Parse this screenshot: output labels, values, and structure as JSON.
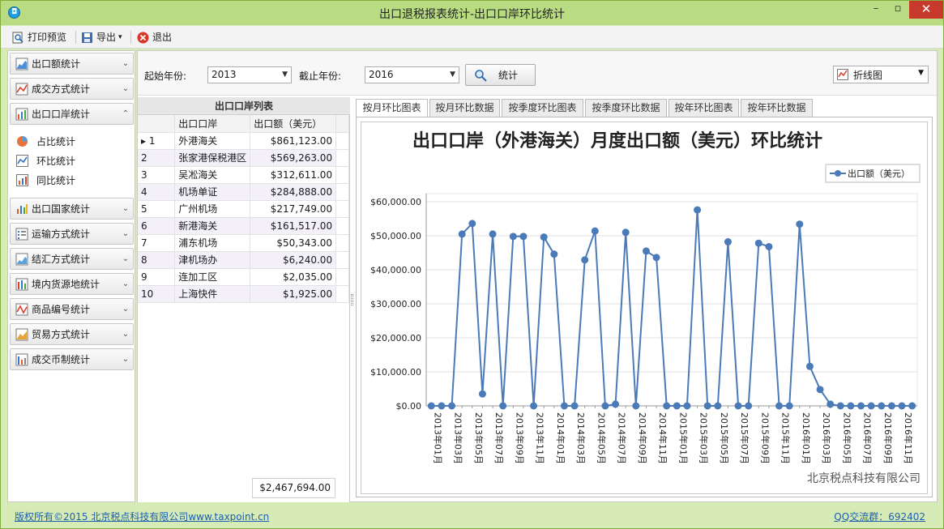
{
  "window": {
    "title": "出口退税报表统计-出口口岸环比统计"
  },
  "toolbar": {
    "print_preview": "打印预览",
    "export": "导出",
    "exit": "退出"
  },
  "sidebar": {
    "groups": [
      {
        "label": "出口额统计",
        "expanded": false
      },
      {
        "label": "成交方式统计",
        "expanded": false
      },
      {
        "label": "出口口岸统计",
        "expanded": true
      },
      {
        "label": "出口国家统计",
        "expanded": false
      },
      {
        "label": "运输方式统计",
        "expanded": false
      },
      {
        "label": "结汇方式统计",
        "expanded": false
      },
      {
        "label": "境内货源地统计",
        "expanded": false
      },
      {
        "label": "商品编号统计",
        "expanded": false
      },
      {
        "label": "贸易方式统计",
        "expanded": false
      },
      {
        "label": "成交币制统计",
        "expanded": false
      }
    ],
    "sub_items": [
      "占比统计",
      "环比统计",
      "同比统计"
    ]
  },
  "filters": {
    "start_label": "起始年份:",
    "start_value": "2013",
    "end_label": "截止年份:",
    "end_value": "2016",
    "stat_button": "统计",
    "chart_type": "折线图"
  },
  "grid": {
    "caption": "出口口岸列表",
    "columns": [
      "出口口岸",
      "出口额（美元）"
    ],
    "rows": [
      {
        "idx": "1",
        "port": "外港海关",
        "amount": "$861,123.00"
      },
      {
        "idx": "2",
        "port": "张家港保税港区",
        "amount": "$569,263.00"
      },
      {
        "idx": "3",
        "port": "吴凇海关",
        "amount": "$312,611.00"
      },
      {
        "idx": "4",
        "port": "机场单证",
        "amount": "$284,888.00"
      },
      {
        "idx": "5",
        "port": "广州机场",
        "amount": "$217,749.00"
      },
      {
        "idx": "6",
        "port": "新港海关",
        "amount": "$161,517.00"
      },
      {
        "idx": "7",
        "port": "浦东机场",
        "amount": "$50,343.00"
      },
      {
        "idx": "8",
        "port": "津机场办",
        "amount": "$6,240.00"
      },
      {
        "idx": "9",
        "port": "连加工区",
        "amount": "$2,035.00"
      },
      {
        "idx": "10",
        "port": "上海快件",
        "amount": "$1,925.00"
      }
    ],
    "total": "$2,467,694.00"
  },
  "tabs": [
    "按月环比图表",
    "按月环比数据",
    "按季度环比图表",
    "按季度环比数据",
    "按年环比图表",
    "按年环比数据"
  ],
  "chart_data": {
    "type": "line",
    "title": "出口口岸（外港海关）月度出口额（美元）环比统计",
    "legend_position": "top-right",
    "ylim": [
      0,
      60000
    ],
    "y_ticks": [
      "$0.00",
      "$10,000.00",
      "$20,000.00",
      "$30,000.00",
      "$40,000.00",
      "$50,000.00",
      "$60,000.00"
    ],
    "x_tick_labels": [
      "2013年01月",
      "2013年03月",
      "2013年05月",
      "2013年07月",
      "2013年09月",
      "2013年11月",
      "2014年01月",
      "2014年03月",
      "2014年05月",
      "2014年07月",
      "2014年09月",
      "2014年11月",
      "2015年01月",
      "2015年03月",
      "2015年05月",
      "2015年07月",
      "2015年09月",
      "2015年11月",
      "2016年01月",
      "2016年03月",
      "2016年05月",
      "2016年07月",
      "2016年09月",
      "2016年11月"
    ],
    "series": [
      {
        "name": "出口额（美元）",
        "color": "#4a7ab8",
        "values": [
          0,
          0,
          0,
          50500,
          53600,
          3500,
          50500,
          0,
          49800,
          49800,
          0,
          49600,
          44600,
          0,
          0,
          42900,
          51400,
          0,
          500,
          51000,
          0,
          45500,
          43600,
          0,
          0,
          0,
          57600,
          0,
          0,
          48200,
          0,
          0,
          47800,
          46800,
          0,
          0,
          53400,
          11600,
          4800,
          500,
          0,
          0,
          0,
          0,
          0,
          0,
          0,
          0
        ]
      }
    ],
    "watermark": "北京税点科技有限公司"
  },
  "status": {
    "left": "版权所有©2015 北京税点科技有限公司www.taxpoint.cn",
    "right": "QQ交流群：692402"
  },
  "colors": {
    "accent": "#b9dc83",
    "line": "#4a7ab8",
    "close": "#c7392b"
  }
}
